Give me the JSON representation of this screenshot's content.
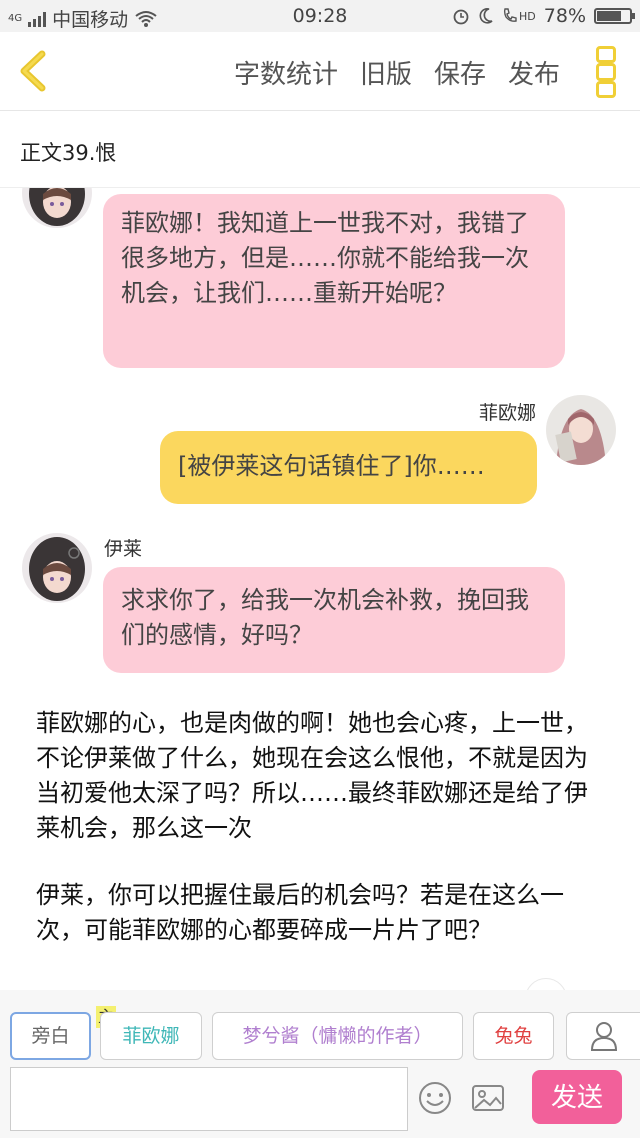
{
  "status": {
    "network_badge": "4G",
    "carrier": "中国移动",
    "time": "09:28",
    "hd": "HD",
    "battery": "78%",
    "battery_level": 0.78
  },
  "toolbar": {
    "actions": [
      "字数统计",
      "旧版",
      "保存",
      "发布"
    ]
  },
  "chapter": {
    "title": "正文39.恨"
  },
  "chat": {
    "messages": [
      {
        "speaker": "",
        "side": "left",
        "text": "菲欧娜！我知道上一世我不对，我错了很多地方，但是……你就不能给我一次机会，让我们……重新开始呢？"
      },
      {
        "speaker": "菲欧娜",
        "side": "right",
        "text": "[被伊莱这句话镇住了]你……"
      },
      {
        "speaker": "伊莱",
        "side": "left",
        "text": "求求你了，给我一次机会补救，挽回我们的感情，好吗？"
      }
    ],
    "narrations": [
      "菲欧娜的心，也是肉做的啊！她也会心疼，上一世，不论伊莱做了什么，她现在会这么恨他，不就是因为当初爱他太深了吗？所以……最终菲欧娜还是给了伊莱机会，那么这一次",
      "伊莱，你可以把握住最后的机会吗？若是在这么一次，可能菲欧娜的心都要碎成一片片了吧？"
    ]
  },
  "roles": {
    "items": [
      {
        "label": "旁白",
        "color": "#666666"
      },
      {
        "label": "菲欧娜",
        "color": "#3fb7b7"
      },
      {
        "label": "梦兮酱（慵懒的作者）",
        "color": "#b07fcf"
      },
      {
        "label": "兔兔",
        "color": "#e04040"
      }
    ],
    "main_mark": "主"
  },
  "input": {
    "placeholder": "",
    "send_label": "发送"
  },
  "colors": {
    "accent": "#f0cf36",
    "pink_bubble": "#fdccd7",
    "yellow_bubble": "#fbd75e",
    "send": "#f2609a"
  }
}
